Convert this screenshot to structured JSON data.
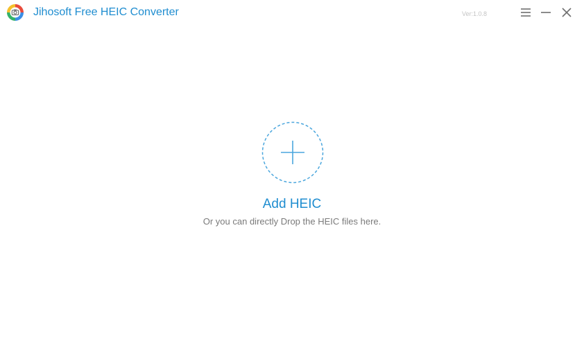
{
  "app": {
    "title": "Jihosoft Free HEIC Converter",
    "version": "Ver:1.0.8",
    "logo_icon": "camera-aperture-logo-icon"
  },
  "window_controls": {
    "menu_icon": "hamburger-menu-icon",
    "minimize_icon": "minimize-icon",
    "close_icon": "close-icon"
  },
  "drop_zone": {
    "add_icon": "plus-icon",
    "add_label": "Add HEIC",
    "hint": "Or you can directly Drop the HEIC files here."
  },
  "colors": {
    "accent": "#1f8dd0",
    "dashed_circle": "#4aa6dd",
    "hint_text": "#7a7a7a",
    "version_text": "#c4c4c4",
    "control_icon": "#6e6e6e"
  }
}
